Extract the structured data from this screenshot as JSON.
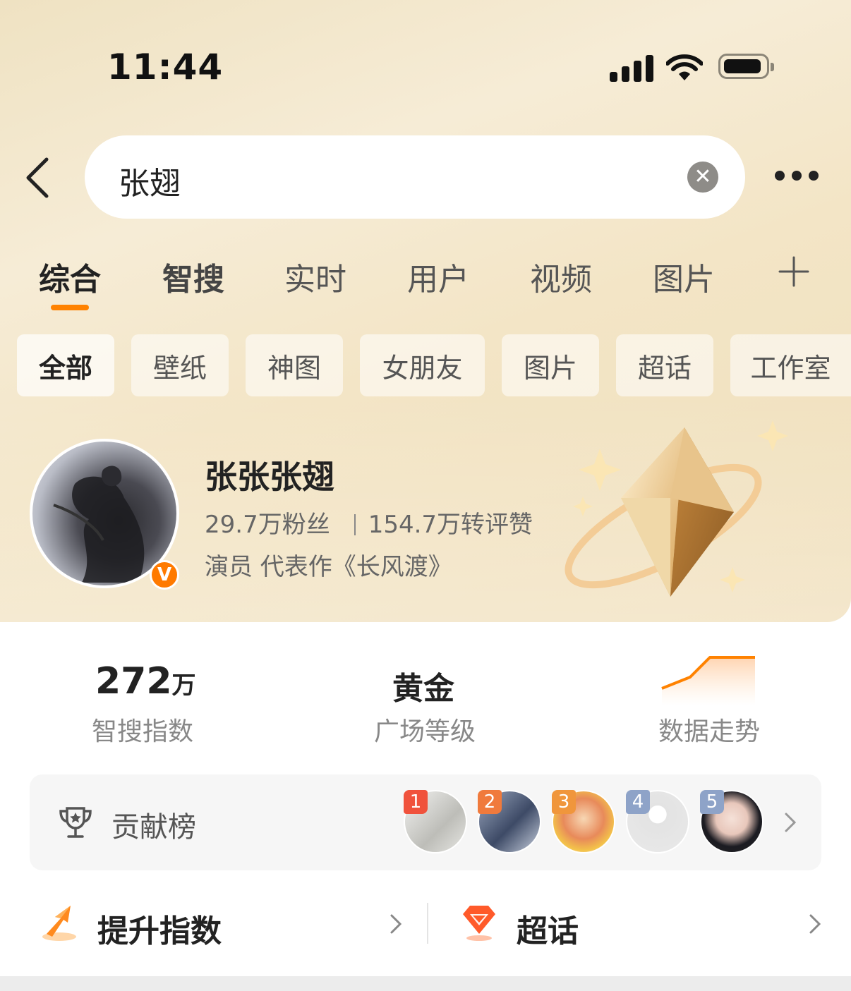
{
  "status_bar": {
    "time": "11:44"
  },
  "search": {
    "query": "张翅"
  },
  "tabs": [
    {
      "label": "综合",
      "active": true
    },
    {
      "label": "智搜",
      "active": false
    },
    {
      "label": "实时",
      "active": false
    },
    {
      "label": "用户",
      "active": false
    },
    {
      "label": "视频",
      "active": false
    },
    {
      "label": "图片",
      "active": false
    }
  ],
  "chips": [
    {
      "label": "全部",
      "active": true
    },
    {
      "label": "壁纸"
    },
    {
      "label": "神图"
    },
    {
      "label": "女朋友"
    },
    {
      "label": "图片"
    },
    {
      "label": "超话"
    },
    {
      "label": "工作室"
    }
  ],
  "profile": {
    "name": "张张张翅",
    "fans": "29.7万粉丝",
    "interactions": "154.7万转评赞",
    "bio": "演员 代表作《长风渡》",
    "verified_badge": "V"
  },
  "metrics": [
    {
      "value": "272",
      "unit": "万",
      "label": "智搜指数"
    },
    {
      "value": "黄金",
      "label": "广场等级"
    },
    {
      "label": "数据走势"
    }
  ],
  "contribution": {
    "label": "贡献榜",
    "ranks": [
      "1",
      "2",
      "3",
      "4",
      "5"
    ]
  },
  "bottom_links": [
    {
      "label": "提升指数"
    },
    {
      "label": "超话"
    }
  ],
  "colors": {
    "accent": "#ff8200",
    "rank1": "#f0523c",
    "rank2": "#f07a3c",
    "rank3": "#f0963c",
    "rank4": "#8ea3c8",
    "rank5": "#8ea3c8"
  }
}
